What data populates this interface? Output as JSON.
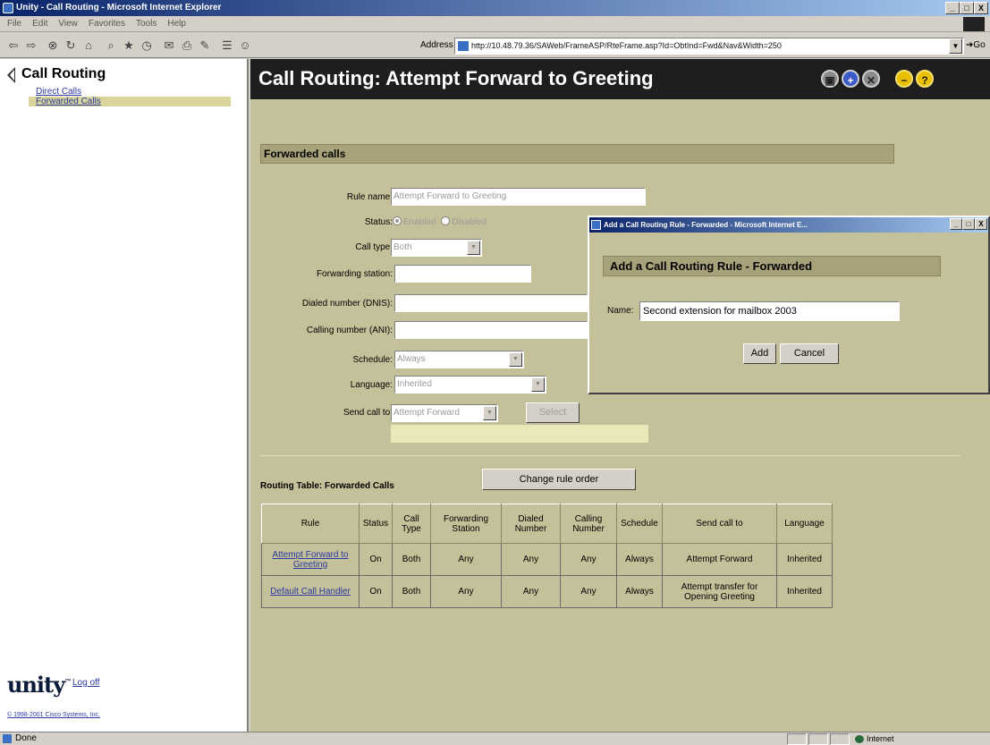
{
  "window": {
    "title": "Unity - Call Routing - Microsoft Internet Explorer",
    "controls": [
      "_",
      "□",
      "X"
    ]
  },
  "menubar": {
    "items": [
      "File",
      "Edit",
      "View",
      "Favorites",
      "Tools",
      "Help"
    ]
  },
  "toolbar": {
    "address_label": "Address",
    "url": "http://10.48.79.36/SAWeb/FrameASP/RteFrame.asp?Id=ObtInd=Fwd&Nav&Width=250",
    "go_label": "Go"
  },
  "sidebar": {
    "title": "Call Routing",
    "items": [
      {
        "label": "Direct Calls",
        "selected": false
      },
      {
        "label": "Forwarded Calls",
        "selected": true
      }
    ],
    "logo_text": "unity",
    "logoff_label": "Log off",
    "copyright": "© 1998-2001 Cisco Systems, Inc."
  },
  "header": {
    "title": "Call Routing: Attempt Forward to Greeting",
    "icons": [
      "save-icon",
      "add-icon",
      "delete-icon",
      "back-icon",
      "help-icon"
    ]
  },
  "form": {
    "section_title": "Forwarded calls",
    "rule_name_label": "Rule name:",
    "rule_name_value": "Attempt Forward to Greeting",
    "status_label": "Status:",
    "status_enabled": "Enabled",
    "status_disabled": "Disabled",
    "call_type_label": "Call type:",
    "call_type_value": "Both",
    "forwarding_station_label": "Forwarding station:",
    "forwarding_station_value": "",
    "dnis_label": "Dialed number (DNIS):",
    "dnis_value": "",
    "ani_label": "Calling number (ANI):",
    "ani_value": "",
    "schedule_label": "Schedule:",
    "schedule_value": "Always",
    "language_label": "Language:",
    "language_value": "Inherited",
    "send_call_label": "Send call to:",
    "send_call_value": "Attempt Forward",
    "select_label": "Select"
  },
  "routing_table": {
    "title": "Routing Table: Forwarded Calls",
    "change_order_label": "Change rule order",
    "columns": [
      "Rule",
      "Status",
      "Call Type",
      "Forwarding Station",
      "Dialed Number",
      "Calling Number",
      "Schedule",
      "Send call to",
      "Language"
    ],
    "rows": [
      [
        "Attempt Forward to Greeting",
        "On",
        "Both",
        "Any",
        "Any",
        "Any",
        "Always",
        "Attempt Forward",
        "Inherited"
      ],
      [
        "Default Call Handler",
        "On",
        "Both",
        "Any",
        "Any",
        "Any",
        "Always",
        "Attempt transfer for Opening Greeting",
        "Inherited"
      ]
    ]
  },
  "dialog": {
    "title": "Add a Call Routing Rule - Forwarded - Microsoft Internet E...",
    "heading": "Add a Call Routing Rule - Forwarded",
    "name_label": "Name:",
    "name_value": "Second extension for mailbox 2003",
    "add_label": "Add",
    "cancel_label": "Cancel"
  },
  "statusbar": {
    "text": "Done",
    "zone": "Internet"
  },
  "colors": {
    "title_blue": "#0a246a",
    "panel_khaki": "#c4c09a",
    "section_bar": "#a7a27a",
    "link_blue": "#2a3aa0"
  }
}
